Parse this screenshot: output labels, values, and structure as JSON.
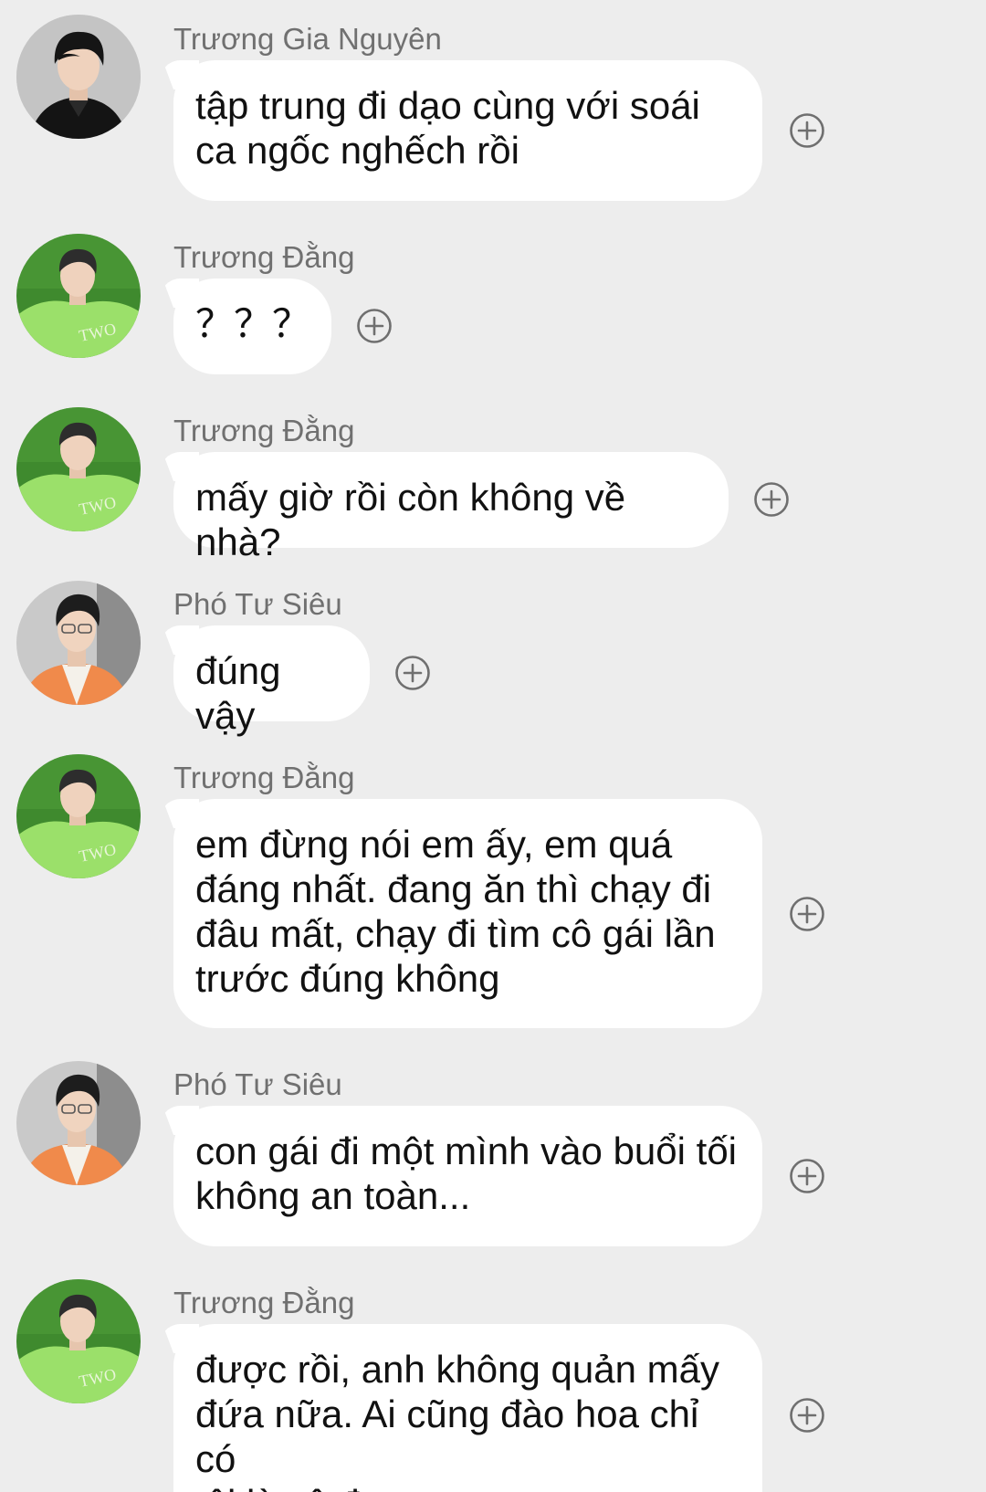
{
  "messages": [
    {
      "sender": "Trương Gia Nguyên",
      "avatar": "avatar-black-shirt",
      "text": "tập trung đi dạo cùng với soái\nca ngốc nghếch rồi"
    },
    {
      "sender": "Trương Đằng",
      "avatar": "avatar-green-shirt",
      "text": "？？？"
    },
    {
      "sender": "Trương Đằng",
      "avatar": "avatar-green-shirt",
      "text": "mấy giờ rồi còn không về nhà?"
    },
    {
      "sender": "Phó Tư Siêu",
      "avatar": "avatar-orange-shirt",
      "text": "đúng vậy"
    },
    {
      "sender": "Trương Đằng",
      "avatar": "avatar-green-shirt",
      "text": "em đừng nói em ấy, em quá\nđáng nhất. đang ăn thì chạy đi\nđâu mất, chạy đi tìm cô gái lần\ntrước đúng không"
    },
    {
      "sender": "Phó Tư Siêu",
      "avatar": "avatar-orange-shirt",
      "text": "con gái đi một mình vào buổi tối\nkhông an toàn..."
    },
    {
      "sender": "Trương Đằng",
      "avatar": "avatar-green-shirt",
      "text": "được rồi, anh không quản mấy\nđứa nữa. Ai cũng đào hoa chỉ có\ntôi là cô đơn"
    }
  ],
  "icons": {
    "reaction": "plus-circle-icon"
  },
  "colors": {
    "background": "#ededed",
    "bubble": "#ffffff",
    "sender_name": "#707070",
    "text": "#111111",
    "green_shirt": "#9be06a",
    "grass": "#3f8a2e",
    "orange_shirt": "#f08a4b"
  }
}
